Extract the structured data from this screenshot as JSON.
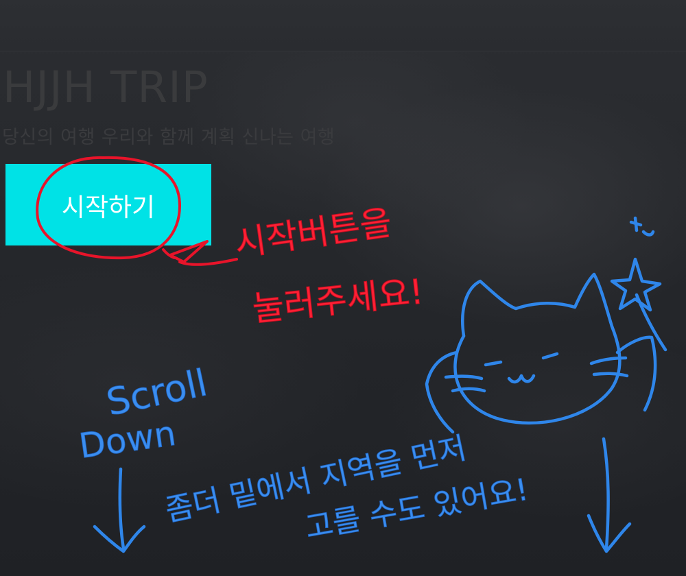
{
  "hero": {
    "title": "HJJH TRIP",
    "subtitle": "당신의 여행 우리와 함께 계획 신나는 여행",
    "start_button_label": "시작하기"
  },
  "annotations": {
    "start_hint_line1": "시작버튼을",
    "start_hint_line2": "눌러주세요!",
    "scroll_word1": "Scroll",
    "scroll_word2": "Down",
    "region_hint_line1": "좀더 밑에서 지역을 먼저",
    "region_hint_line2": "고를 수도 있어요!"
  },
  "colors": {
    "background": "#25272b",
    "start_button": "#00e2e6",
    "annotation_red": "#e8142a",
    "annotation_blue": "#2f86ea"
  },
  "icons": {
    "cat_doodle": "cat-doodle-icon",
    "star_wand": "star-wand-icon",
    "arrow": "arrow-down-icon"
  }
}
